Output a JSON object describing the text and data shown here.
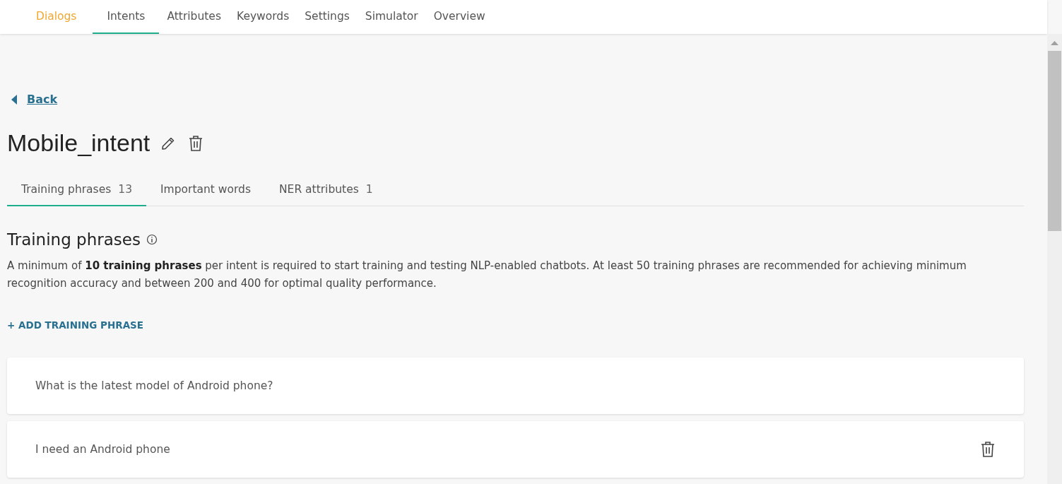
{
  "nav": [
    {
      "label": "Dialogs",
      "selected": false,
      "highlighted": true
    },
    {
      "label": "Intents",
      "selected": true,
      "highlighted": false
    },
    {
      "label": "Attributes",
      "selected": false,
      "highlighted": false
    },
    {
      "label": "Keywords",
      "selected": false,
      "highlighted": false
    },
    {
      "label": "Settings",
      "selected": false,
      "highlighted": false
    },
    {
      "label": "Simulator",
      "selected": false,
      "highlighted": false
    },
    {
      "label": "Overview",
      "selected": false,
      "highlighted": false
    }
  ],
  "back": "Back",
  "intent_title": "Mobile_intent",
  "tabs": [
    {
      "label": "Training phrases",
      "count": "13",
      "selected": true
    },
    {
      "label": "Important words",
      "selected": false
    },
    {
      "label": "NER attributes",
      "count": "1",
      "selected": false
    }
  ],
  "section": {
    "heading": "Training phrases",
    "description": "A minimum of **10 training phrases** per intent is required to start training and testing NLP-enabled chatbots. At least 50 training phrases are recommended for achieving minimum recognition accuracy and between 200 and 400 for optimal quality performance.",
    "add_button": "+ ADD TRAINING PHRASE"
  },
  "phrases": [
    {
      "text": "What is the latest model of Android phone?",
      "delete_visible": false
    },
    {
      "text": "I need an Android phone",
      "delete_visible": true
    }
  ]
}
